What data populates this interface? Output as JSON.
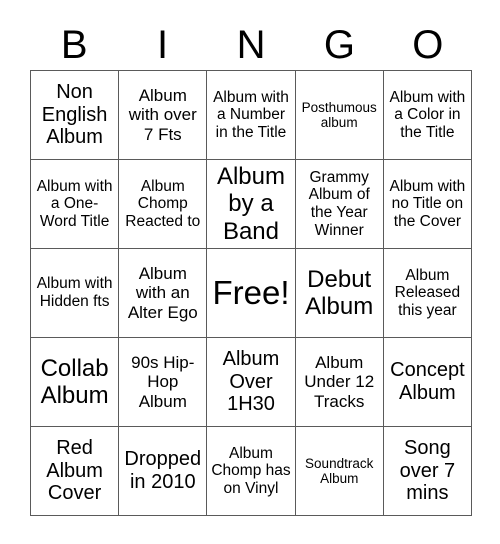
{
  "card": {
    "header_letters": [
      "B",
      "I",
      "N",
      "G",
      "O"
    ],
    "free_space_index": 12,
    "colors": {
      "background": "#ffffff",
      "text": "#000000",
      "grid_line": "#5a5a5a"
    },
    "cells": [
      {
        "text": "Non English Album",
        "size": "l"
      },
      {
        "text": "Album with over 7 Fts",
        "size": "m"
      },
      {
        "text": "Album with a Number in the Title",
        "size": "s"
      },
      {
        "text": "Posthumous album",
        "size": "xs"
      },
      {
        "text": "Album with a Color in the Title",
        "size": "s"
      },
      {
        "text": "Album with a One-Word Title",
        "size": "s"
      },
      {
        "text": "Album Chomp Reacted to",
        "size": "s"
      },
      {
        "text": "Album by a Band",
        "size": "xl"
      },
      {
        "text": "Grammy Album of the Year Winner",
        "size": "s"
      },
      {
        "text": "Album with no Title on the Cover",
        "size": "s"
      },
      {
        "text": "Album with Hidden fts",
        "size": "s"
      },
      {
        "text": "Album with an Alter Ego",
        "size": "m"
      },
      {
        "text": "Free!",
        "size": "xxl"
      },
      {
        "text": "Debut Album",
        "size": "xl"
      },
      {
        "text": "Album Released this year",
        "size": "s"
      },
      {
        "text": "Collab Album",
        "size": "xl"
      },
      {
        "text": "90s Hip-Hop Album",
        "size": "m"
      },
      {
        "text": "Album Over 1H30",
        "size": "l"
      },
      {
        "text": "Album Under 12 Tracks",
        "size": "m"
      },
      {
        "text": "Concept Album",
        "size": "l"
      },
      {
        "text": "Red Album Cover",
        "size": "l"
      },
      {
        "text": "Dropped in 2010",
        "size": "l"
      },
      {
        "text": "Album Chomp has on Vinyl",
        "size": "s"
      },
      {
        "text": "Soundtrack Album",
        "size": "xs"
      },
      {
        "text": "Song over 7 mins",
        "size": "l"
      }
    ]
  }
}
